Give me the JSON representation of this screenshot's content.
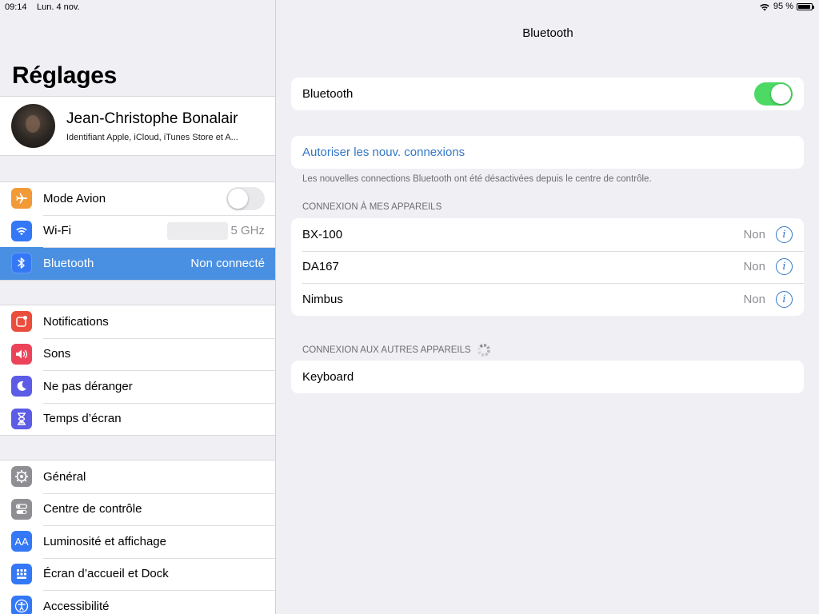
{
  "status_bar": {
    "time": "09:14",
    "date": "Lun. 4 nov.",
    "battery": "95 %",
    "battery_level": 0.95
  },
  "sidebar": {
    "title": "Réglages",
    "profile": {
      "name": "Jean-Christophe Bonalair",
      "subtitle": "Identifiant Apple, iCloud, iTunes Store et A..."
    },
    "group1": [
      {
        "label": "Mode Avion",
        "icon": "airplane-icon",
        "color": "#f19a37",
        "toggle": false
      },
      {
        "label": "Wi-Fi",
        "icon": "wifi-icon",
        "color": "#3478f6",
        "value": "5 GHz"
      },
      {
        "label": "Bluetooth",
        "icon": "bluetooth-icon",
        "color": "#3478f6",
        "value": "Non connecté",
        "selected": true
      }
    ],
    "group2": [
      {
        "label": "Notifications",
        "icon": "notifications-icon",
        "color": "#eb4d3d"
      },
      {
        "label": "Sons",
        "icon": "speaker-icon",
        "color": "#eb445a"
      },
      {
        "label": "Ne pas déranger",
        "icon": "moon-icon",
        "color": "#5d5ce6"
      },
      {
        "label": "Temps d’écran",
        "icon": "hourglass-icon",
        "color": "#5d5ce6"
      }
    ],
    "group3": [
      {
        "label": "Général",
        "icon": "gear-icon",
        "color": "#8e8e93"
      },
      {
        "label": "Centre de contrôle",
        "icon": "switches-icon",
        "color": "#8e8e93"
      },
      {
        "label": "Luminosité et affichage",
        "icon": "text-size-icon",
        "color": "#3478f6",
        "glyph": "AA"
      },
      {
        "label": "Écran d’accueil et Dock",
        "icon": "home-grid-icon",
        "color": "#3478f6"
      },
      {
        "label": "Accessibilité",
        "icon": "accessibility-icon",
        "color": "#3478f6"
      }
    ]
  },
  "main": {
    "title": "Bluetooth",
    "bluetooth_label": "Bluetooth",
    "bluetooth_on": true,
    "allow_link": "Autoriser les nouv. connexions",
    "note": "Les nouvelles connections Bluetooth ont été désactivées depuis le centre de contrôle.",
    "my_devices_header": "CONNEXION À MES APPAREILS",
    "my_devices": [
      {
        "name": "BX-100",
        "status": "Non"
      },
      {
        "name": "DA167",
        "status": "Non"
      },
      {
        "name": "Nimbus",
        "status": "Non"
      }
    ],
    "other_devices_header": "CONNEXION AUX AUTRES APPAREILS",
    "other_devices": [
      {
        "name": "Keyboard"
      }
    ]
  },
  "colors": {
    "selected_row": "#4a90e2",
    "toggle_on": "#4cd964",
    "link": "#3477c7"
  }
}
